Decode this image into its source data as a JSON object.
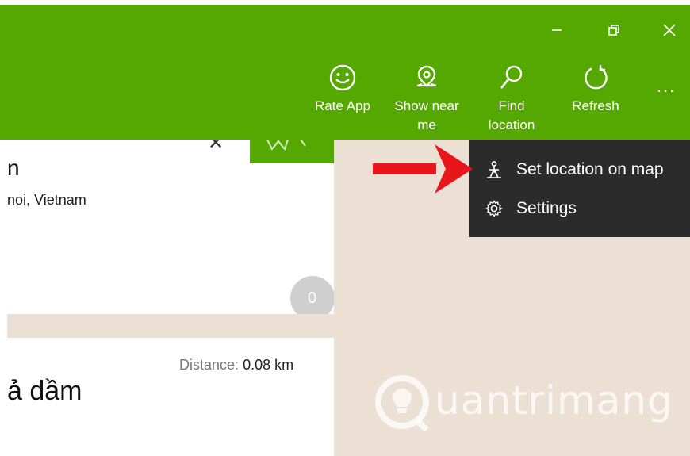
{
  "window": {
    "controls": {
      "minimize": "minimize-icon",
      "restore": "restore-icon",
      "close": "close-icon"
    }
  },
  "toolbar": {
    "rate_app": "Rate App",
    "show_near_line1": "Show near",
    "show_near_line2": "me",
    "find_line1": "Find",
    "find_line2": "location",
    "refresh": "Refresh",
    "more": "..."
  },
  "menu": {
    "items": [
      {
        "label": "Set location on map",
        "icon": "map-pin-person-icon"
      },
      {
        "label": "Settings",
        "icon": "gear-icon"
      }
    ]
  },
  "results": [
    {
      "name": "n",
      "address": "noi, Vietnam",
      "count": "0"
    },
    {
      "distance_label": "Distance:",
      "distance_value": "0.08 km",
      "name": "ả dầm"
    }
  ],
  "watermark": {
    "text": "uantrimang"
  },
  "colors": {
    "accent": "#55a800",
    "menu_bg": "#2b2b2b",
    "map_bg": "#ecdfd4",
    "arrow": "#e8161b"
  }
}
